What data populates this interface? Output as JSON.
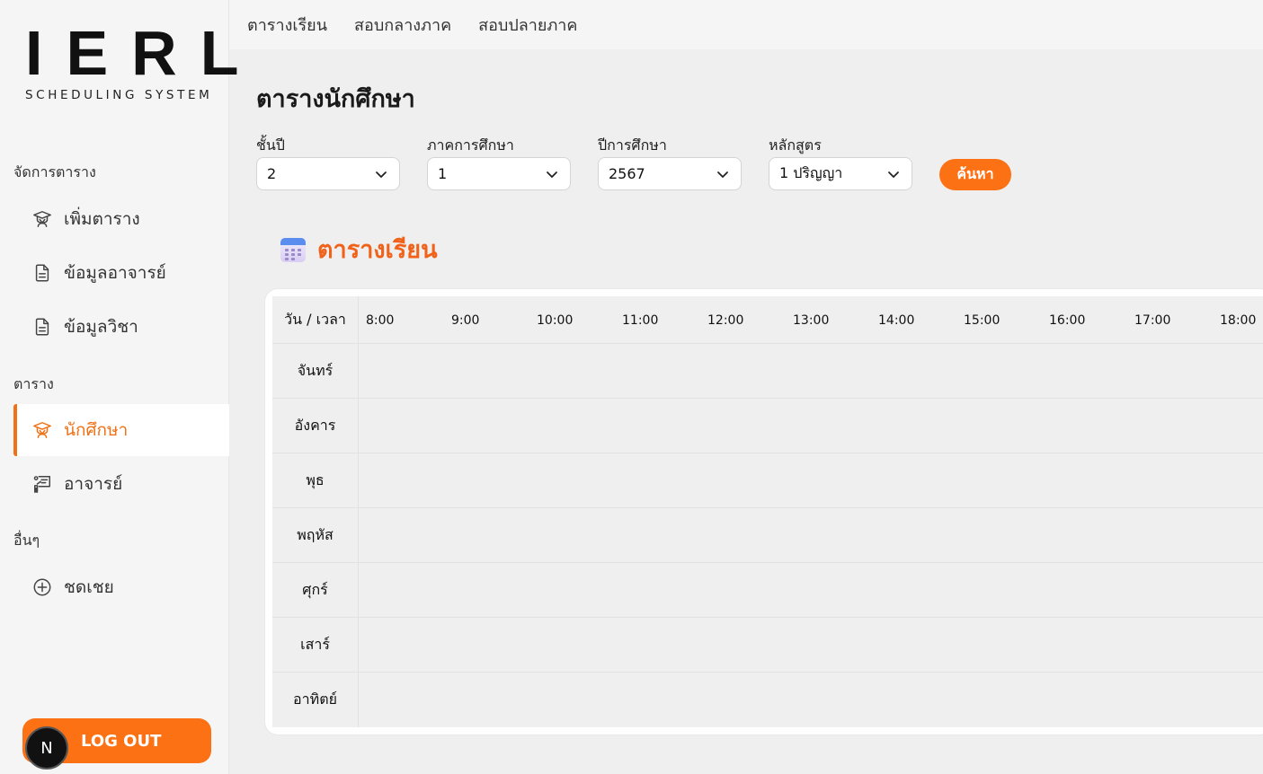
{
  "brand": {
    "logo_text": "IERL",
    "subtitle": "SCHEDULING SYSTEM"
  },
  "sidebar": {
    "sections": [
      {
        "heading": "จัดการตาราง",
        "items": [
          {
            "label": "เพิ่มตาราง",
            "icon": "graduate-icon"
          },
          {
            "label": "ข้อมูลอาจารย์",
            "icon": "document-icon"
          },
          {
            "label": "ข้อมูลวิชา",
            "icon": "document-icon"
          }
        ]
      },
      {
        "heading": "ตาราง",
        "items": [
          {
            "label": "นักศึกษา",
            "icon": "graduate-icon",
            "active": true
          },
          {
            "label": "อาจารย์",
            "icon": "teacher-board-icon"
          }
        ]
      },
      {
        "heading": "อื่นๆ",
        "items": [
          {
            "label": "ชดเชย",
            "icon": "plus-circle-icon"
          }
        ]
      }
    ],
    "logout": {
      "avatar_letter": "N",
      "label": "LOG OUT"
    }
  },
  "topnav": [
    "ตารางเรียน",
    "สอบกลางภาค",
    "สอบปลายภาค"
  ],
  "page_title": "ตารางนักศึกษา",
  "filters": [
    {
      "label": "ชั้นปี",
      "value": "2"
    },
    {
      "label": "ภาคการศึกษา",
      "value": "1"
    },
    {
      "label": "ปีการศึกษา",
      "value": "2567"
    },
    {
      "label": "หลักสูตร",
      "value": "1 ปริญญา"
    }
  ],
  "search_label": "ค้นหา",
  "schedule": {
    "title": "ตารางเรียน",
    "corner_label": "วัน / เวลา",
    "times": [
      "8:00",
      "9:00",
      "10:00",
      "11:00",
      "12:00",
      "13:00",
      "14:00",
      "15:00",
      "16:00",
      "17:00",
      "18:00"
    ],
    "days": [
      "จันทร์",
      "อังคาร",
      "พุธ",
      "พฤหัส",
      "ศุกร์",
      "เสาร์",
      "อาทิตย์"
    ]
  },
  "colors": {
    "accent": "#fb7114",
    "accent_text": "#f07116",
    "title_orange": "#f0621a"
  }
}
